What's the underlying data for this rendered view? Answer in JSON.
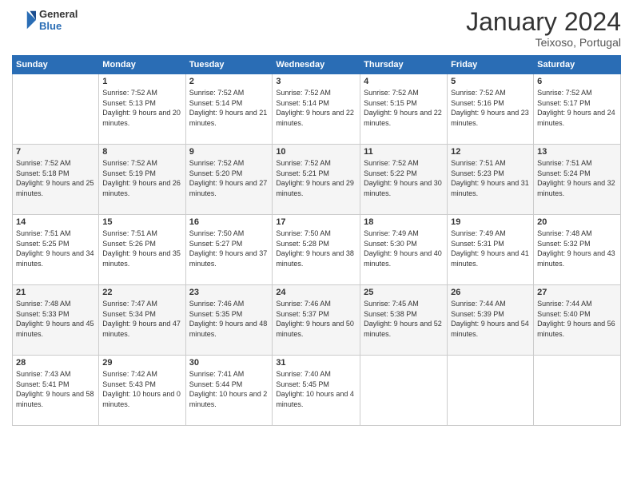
{
  "header": {
    "logo_general": "General",
    "logo_blue": "Blue",
    "month_title": "January 2024",
    "location": "Teixoso, Portugal"
  },
  "weekdays": [
    "Sunday",
    "Monday",
    "Tuesday",
    "Wednesday",
    "Thursday",
    "Friday",
    "Saturday"
  ],
  "weeks": [
    [
      {
        "day": "",
        "sunrise": "",
        "sunset": "",
        "daylight": ""
      },
      {
        "day": "1",
        "sunrise": "Sunrise: 7:52 AM",
        "sunset": "Sunset: 5:13 PM",
        "daylight": "Daylight: 9 hours and 20 minutes."
      },
      {
        "day": "2",
        "sunrise": "Sunrise: 7:52 AM",
        "sunset": "Sunset: 5:14 PM",
        "daylight": "Daylight: 9 hours and 21 minutes."
      },
      {
        "day": "3",
        "sunrise": "Sunrise: 7:52 AM",
        "sunset": "Sunset: 5:14 PM",
        "daylight": "Daylight: 9 hours and 22 minutes."
      },
      {
        "day": "4",
        "sunrise": "Sunrise: 7:52 AM",
        "sunset": "Sunset: 5:15 PM",
        "daylight": "Daylight: 9 hours and 22 minutes."
      },
      {
        "day": "5",
        "sunrise": "Sunrise: 7:52 AM",
        "sunset": "Sunset: 5:16 PM",
        "daylight": "Daylight: 9 hours and 23 minutes."
      },
      {
        "day": "6",
        "sunrise": "Sunrise: 7:52 AM",
        "sunset": "Sunset: 5:17 PM",
        "daylight": "Daylight: 9 hours and 24 minutes."
      }
    ],
    [
      {
        "day": "7",
        "sunrise": "Sunrise: 7:52 AM",
        "sunset": "Sunset: 5:18 PM",
        "daylight": "Daylight: 9 hours and 25 minutes."
      },
      {
        "day": "8",
        "sunrise": "Sunrise: 7:52 AM",
        "sunset": "Sunset: 5:19 PM",
        "daylight": "Daylight: 9 hours and 26 minutes."
      },
      {
        "day": "9",
        "sunrise": "Sunrise: 7:52 AM",
        "sunset": "Sunset: 5:20 PM",
        "daylight": "Daylight: 9 hours and 27 minutes."
      },
      {
        "day": "10",
        "sunrise": "Sunrise: 7:52 AM",
        "sunset": "Sunset: 5:21 PM",
        "daylight": "Daylight: 9 hours and 29 minutes."
      },
      {
        "day": "11",
        "sunrise": "Sunrise: 7:52 AM",
        "sunset": "Sunset: 5:22 PM",
        "daylight": "Daylight: 9 hours and 30 minutes."
      },
      {
        "day": "12",
        "sunrise": "Sunrise: 7:51 AM",
        "sunset": "Sunset: 5:23 PM",
        "daylight": "Daylight: 9 hours and 31 minutes."
      },
      {
        "day": "13",
        "sunrise": "Sunrise: 7:51 AM",
        "sunset": "Sunset: 5:24 PM",
        "daylight": "Daylight: 9 hours and 32 minutes."
      }
    ],
    [
      {
        "day": "14",
        "sunrise": "Sunrise: 7:51 AM",
        "sunset": "Sunset: 5:25 PM",
        "daylight": "Daylight: 9 hours and 34 minutes."
      },
      {
        "day": "15",
        "sunrise": "Sunrise: 7:51 AM",
        "sunset": "Sunset: 5:26 PM",
        "daylight": "Daylight: 9 hours and 35 minutes."
      },
      {
        "day": "16",
        "sunrise": "Sunrise: 7:50 AM",
        "sunset": "Sunset: 5:27 PM",
        "daylight": "Daylight: 9 hours and 37 minutes."
      },
      {
        "day": "17",
        "sunrise": "Sunrise: 7:50 AM",
        "sunset": "Sunset: 5:28 PM",
        "daylight": "Daylight: 9 hours and 38 minutes."
      },
      {
        "day": "18",
        "sunrise": "Sunrise: 7:49 AM",
        "sunset": "Sunset: 5:30 PM",
        "daylight": "Daylight: 9 hours and 40 minutes."
      },
      {
        "day": "19",
        "sunrise": "Sunrise: 7:49 AM",
        "sunset": "Sunset: 5:31 PM",
        "daylight": "Daylight: 9 hours and 41 minutes."
      },
      {
        "day": "20",
        "sunrise": "Sunrise: 7:48 AM",
        "sunset": "Sunset: 5:32 PM",
        "daylight": "Daylight: 9 hours and 43 minutes."
      }
    ],
    [
      {
        "day": "21",
        "sunrise": "Sunrise: 7:48 AM",
        "sunset": "Sunset: 5:33 PM",
        "daylight": "Daylight: 9 hours and 45 minutes."
      },
      {
        "day": "22",
        "sunrise": "Sunrise: 7:47 AM",
        "sunset": "Sunset: 5:34 PM",
        "daylight": "Daylight: 9 hours and 47 minutes."
      },
      {
        "day": "23",
        "sunrise": "Sunrise: 7:46 AM",
        "sunset": "Sunset: 5:35 PM",
        "daylight": "Daylight: 9 hours and 48 minutes."
      },
      {
        "day": "24",
        "sunrise": "Sunrise: 7:46 AM",
        "sunset": "Sunset: 5:37 PM",
        "daylight": "Daylight: 9 hours and 50 minutes."
      },
      {
        "day": "25",
        "sunrise": "Sunrise: 7:45 AM",
        "sunset": "Sunset: 5:38 PM",
        "daylight": "Daylight: 9 hours and 52 minutes."
      },
      {
        "day": "26",
        "sunrise": "Sunrise: 7:44 AM",
        "sunset": "Sunset: 5:39 PM",
        "daylight": "Daylight: 9 hours and 54 minutes."
      },
      {
        "day": "27",
        "sunrise": "Sunrise: 7:44 AM",
        "sunset": "Sunset: 5:40 PM",
        "daylight": "Daylight: 9 hours and 56 minutes."
      }
    ],
    [
      {
        "day": "28",
        "sunrise": "Sunrise: 7:43 AM",
        "sunset": "Sunset: 5:41 PM",
        "daylight": "Daylight: 9 hours and 58 minutes."
      },
      {
        "day": "29",
        "sunrise": "Sunrise: 7:42 AM",
        "sunset": "Sunset: 5:43 PM",
        "daylight": "Daylight: 10 hours and 0 minutes."
      },
      {
        "day": "30",
        "sunrise": "Sunrise: 7:41 AM",
        "sunset": "Sunset: 5:44 PM",
        "daylight": "Daylight: 10 hours and 2 minutes."
      },
      {
        "day": "31",
        "sunrise": "Sunrise: 7:40 AM",
        "sunset": "Sunset: 5:45 PM",
        "daylight": "Daylight: 10 hours and 4 minutes."
      },
      {
        "day": "",
        "sunrise": "",
        "sunset": "",
        "daylight": ""
      },
      {
        "day": "",
        "sunrise": "",
        "sunset": "",
        "daylight": ""
      },
      {
        "day": "",
        "sunrise": "",
        "sunset": "",
        "daylight": ""
      }
    ]
  ]
}
